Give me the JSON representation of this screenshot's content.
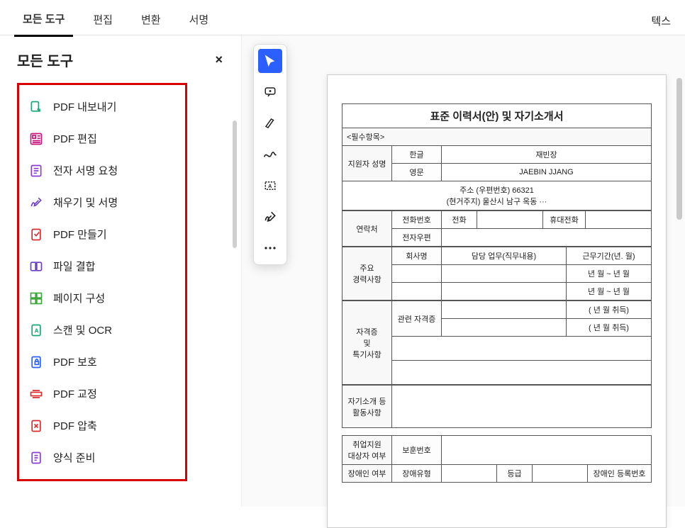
{
  "topbar": {
    "tabs": [
      "모든 도구",
      "편집",
      "변환",
      "서명"
    ],
    "right": "텍스"
  },
  "sidebar": {
    "title": "모든 도구",
    "close": "×",
    "tools": [
      {
        "label": "PDF 내보내기",
        "color": "#1aa772",
        "icon": "export"
      },
      {
        "label": "PDF 편집",
        "color": "#c7157a",
        "icon": "edit"
      },
      {
        "label": "전자 서명 요청",
        "color": "#8a3ed1",
        "icon": "esign"
      },
      {
        "label": "채우기 및 서명",
        "color": "#6b3fc9",
        "icon": "fill"
      },
      {
        "label": "PDF 만들기",
        "color": "#d92c2c",
        "icon": "create"
      },
      {
        "label": "파일 결합",
        "color": "#6b3fc9",
        "icon": "combine"
      },
      {
        "label": "페이지 구성",
        "color": "#3da63d",
        "icon": "organize"
      },
      {
        "label": "스캔 및 OCR",
        "color": "#1aa772",
        "icon": "scan"
      },
      {
        "label": "PDF 보호",
        "color": "#2b5fff",
        "icon": "protect"
      },
      {
        "label": "PDF 교정",
        "color": "#d92c2c",
        "icon": "redact"
      },
      {
        "label": "PDF 압축",
        "color": "#d92c2c",
        "icon": "compress"
      },
      {
        "label": "양식 준비",
        "color": "#8a3ed1",
        "icon": "form"
      }
    ]
  },
  "floating": {
    "items": [
      "select",
      "comment",
      "highlight",
      "draw",
      "textbox",
      "sign",
      "more"
    ]
  },
  "doc": {
    "title": "표준 이력서(안) 및 자기소개서",
    "required": "<필수항목>",
    "applicant_label": "지원자 성명",
    "ko_label": "한글",
    "en_label": "영문",
    "ko_name": "재빈장",
    "en_name": "JAEBIN JJANG",
    "addr_line1": "주소 (우편번호) 66321",
    "addr_line2": "(현거주지) 울산시 남구 옥동 ···",
    "contact_label": "연락처",
    "phone_label": "전화번호",
    "home_label": "전화",
    "mobile_label": "휴대전화",
    "email_label": "전자우편",
    "career_label": "주요\n경력사항",
    "company_label": "회사명",
    "duty_label": "담당 업무(직무내용)",
    "period_label": "근무기간(년. 월)",
    "period_sample1": "년  월 ~ 년  월",
    "period_sample2": "년  월 ~ 년  월",
    "cert_label": "자격증\n및\n특기사항",
    "cert_relevant": "관련 자격증",
    "cert_acq1": "(   년   월 취득)",
    "cert_acq2": "(   년   월 취득)",
    "self_label": "자기소개 등\n활동사항",
    "support_label": "취업지원\n대상자 여부",
    "veteran_label": "보훈번호",
    "disability_label": "장애인 여부",
    "disability_type": "장애유형",
    "disability_grade": "등급",
    "disability_reg": "장애인 등록번호"
  }
}
